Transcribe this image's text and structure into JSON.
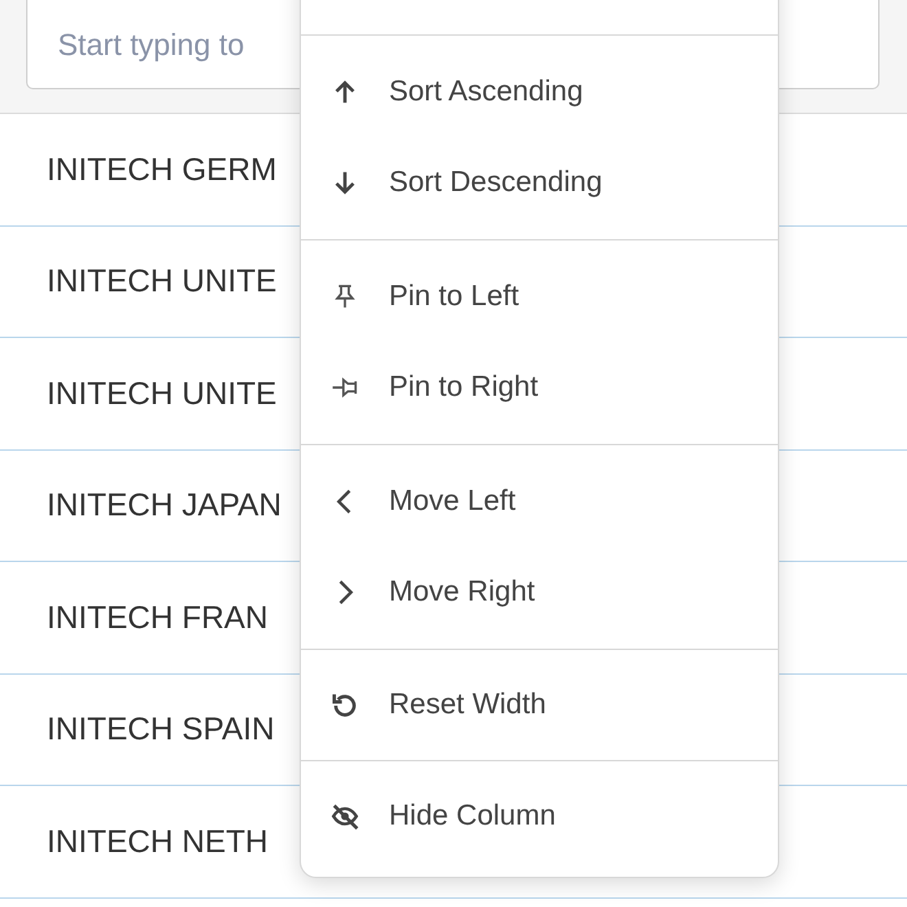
{
  "search": {
    "placeholder": "Start typing to"
  },
  "rows": [
    "INITECH GERM",
    "INITECH UNITE",
    "INITECH UNITE",
    "INITECH JAPAN",
    "INITECH FRAN",
    "INITECH SPAIN",
    "INITECH NETH"
  ],
  "column_menu": {
    "groups": [
      {
        "items": [
          {
            "kind": "ascending",
            "label": "Sort Ascending"
          },
          {
            "kind": "descending",
            "label": "Sort Descending"
          }
        ]
      },
      {
        "items": [
          {
            "kind": "pin-left",
            "label": "Pin to Left"
          },
          {
            "kind": "pin-right",
            "label": "Pin to Right"
          }
        ]
      },
      {
        "items": [
          {
            "kind": "left",
            "label": "Move Left"
          },
          {
            "kind": "right",
            "label": "Move Right"
          }
        ]
      },
      {
        "items": [
          {
            "kind": "reset",
            "label": "Reset Width"
          }
        ]
      },
      {
        "items": [
          {
            "kind": "hide",
            "label": "Hide Column"
          }
        ]
      }
    ]
  }
}
